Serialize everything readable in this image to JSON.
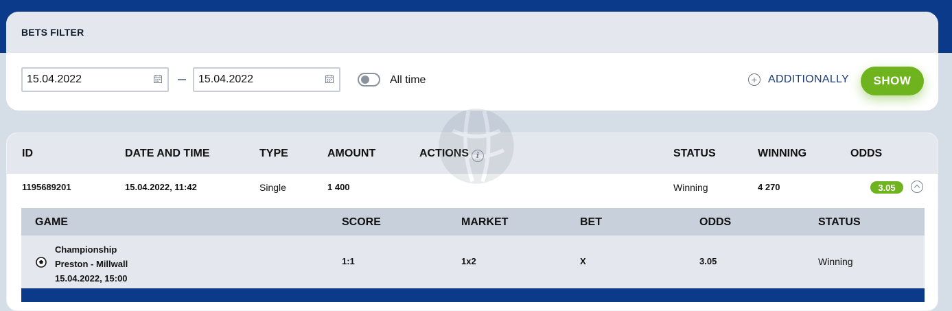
{
  "filter": {
    "title": "BETS FILTER",
    "date_from": "15.04.2022",
    "date_to": "15.04.2022",
    "all_time_label": "All time",
    "all_time_on": false,
    "additionally_label": "ADDITIONALLY",
    "show_label": "SHOW"
  },
  "bets_table": {
    "columns": [
      "ID",
      "DATE AND TIME",
      "TYPE",
      "AMOUNT",
      "ACTIONS",
      "STATUS",
      "WINNING",
      "ODDS"
    ],
    "rows": [
      {
        "id": "1195689201",
        "date_time": "15.04.2022, 11:42",
        "type": "Single",
        "amount": "1 400",
        "status": "Winning",
        "winning": "4 270",
        "odds": "3.05",
        "expanded": true
      }
    ]
  },
  "details_table": {
    "columns": [
      "GAME",
      "SCORE",
      "MARKET",
      "BET",
      "ODDS",
      "STATUS"
    ],
    "rows": [
      {
        "league": "Championship",
        "match": "Preston - Millwall",
        "datetime": "15.04.2022, 15:00",
        "score": "1:1",
        "market": "1x2",
        "bet": "X",
        "odds": "3.05",
        "status": "Winning"
      }
    ]
  },
  "colors": {
    "brand_blue": "#0b3a8a",
    "accent_green": "#6fb31e",
    "header_gray": "#e4e8ee",
    "page_bg": "#d5dde7"
  },
  "icons": [
    "calendar-icon",
    "plus-circle-icon",
    "info-icon",
    "chevron-up-icon",
    "soccer-ball-icon"
  ]
}
